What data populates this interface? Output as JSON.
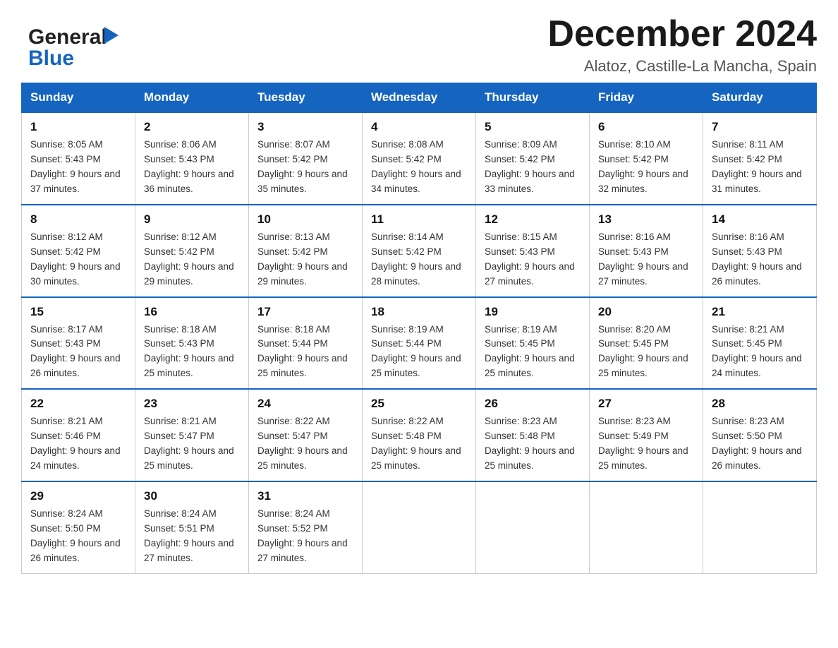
{
  "header": {
    "logo_general": "General",
    "logo_blue": "Blue",
    "month_year": "December 2024",
    "location": "Alatoz, Castille-La Mancha, Spain"
  },
  "weekdays": [
    "Sunday",
    "Monday",
    "Tuesday",
    "Wednesday",
    "Thursday",
    "Friday",
    "Saturday"
  ],
  "weeks": [
    [
      {
        "day": "1",
        "sunrise": "8:05 AM",
        "sunset": "5:43 PM",
        "daylight": "9 hours and 37 minutes."
      },
      {
        "day": "2",
        "sunrise": "8:06 AM",
        "sunset": "5:43 PM",
        "daylight": "9 hours and 36 minutes."
      },
      {
        "day": "3",
        "sunrise": "8:07 AM",
        "sunset": "5:42 PM",
        "daylight": "9 hours and 35 minutes."
      },
      {
        "day": "4",
        "sunrise": "8:08 AM",
        "sunset": "5:42 PM",
        "daylight": "9 hours and 34 minutes."
      },
      {
        "day": "5",
        "sunrise": "8:09 AM",
        "sunset": "5:42 PM",
        "daylight": "9 hours and 33 minutes."
      },
      {
        "day": "6",
        "sunrise": "8:10 AM",
        "sunset": "5:42 PM",
        "daylight": "9 hours and 32 minutes."
      },
      {
        "day": "7",
        "sunrise": "8:11 AM",
        "sunset": "5:42 PM",
        "daylight": "9 hours and 31 minutes."
      }
    ],
    [
      {
        "day": "8",
        "sunrise": "8:12 AM",
        "sunset": "5:42 PM",
        "daylight": "9 hours and 30 minutes."
      },
      {
        "day": "9",
        "sunrise": "8:12 AM",
        "sunset": "5:42 PM",
        "daylight": "9 hours and 29 minutes."
      },
      {
        "day": "10",
        "sunrise": "8:13 AM",
        "sunset": "5:42 PM",
        "daylight": "9 hours and 29 minutes."
      },
      {
        "day": "11",
        "sunrise": "8:14 AM",
        "sunset": "5:42 PM",
        "daylight": "9 hours and 28 minutes."
      },
      {
        "day": "12",
        "sunrise": "8:15 AM",
        "sunset": "5:43 PM",
        "daylight": "9 hours and 27 minutes."
      },
      {
        "day": "13",
        "sunrise": "8:16 AM",
        "sunset": "5:43 PM",
        "daylight": "9 hours and 27 minutes."
      },
      {
        "day": "14",
        "sunrise": "8:16 AM",
        "sunset": "5:43 PM",
        "daylight": "9 hours and 26 minutes."
      }
    ],
    [
      {
        "day": "15",
        "sunrise": "8:17 AM",
        "sunset": "5:43 PM",
        "daylight": "9 hours and 26 minutes."
      },
      {
        "day": "16",
        "sunrise": "8:18 AM",
        "sunset": "5:43 PM",
        "daylight": "9 hours and 25 minutes."
      },
      {
        "day": "17",
        "sunrise": "8:18 AM",
        "sunset": "5:44 PM",
        "daylight": "9 hours and 25 minutes."
      },
      {
        "day": "18",
        "sunrise": "8:19 AM",
        "sunset": "5:44 PM",
        "daylight": "9 hours and 25 minutes."
      },
      {
        "day": "19",
        "sunrise": "8:19 AM",
        "sunset": "5:45 PM",
        "daylight": "9 hours and 25 minutes."
      },
      {
        "day": "20",
        "sunrise": "8:20 AM",
        "sunset": "5:45 PM",
        "daylight": "9 hours and 25 minutes."
      },
      {
        "day": "21",
        "sunrise": "8:21 AM",
        "sunset": "5:45 PM",
        "daylight": "9 hours and 24 minutes."
      }
    ],
    [
      {
        "day": "22",
        "sunrise": "8:21 AM",
        "sunset": "5:46 PM",
        "daylight": "9 hours and 24 minutes."
      },
      {
        "day": "23",
        "sunrise": "8:21 AM",
        "sunset": "5:47 PM",
        "daylight": "9 hours and 25 minutes."
      },
      {
        "day": "24",
        "sunrise": "8:22 AM",
        "sunset": "5:47 PM",
        "daylight": "9 hours and 25 minutes."
      },
      {
        "day": "25",
        "sunrise": "8:22 AM",
        "sunset": "5:48 PM",
        "daylight": "9 hours and 25 minutes."
      },
      {
        "day": "26",
        "sunrise": "8:23 AM",
        "sunset": "5:48 PM",
        "daylight": "9 hours and 25 minutes."
      },
      {
        "day": "27",
        "sunrise": "8:23 AM",
        "sunset": "5:49 PM",
        "daylight": "9 hours and 25 minutes."
      },
      {
        "day": "28",
        "sunrise": "8:23 AM",
        "sunset": "5:50 PM",
        "daylight": "9 hours and 26 minutes."
      }
    ],
    [
      {
        "day": "29",
        "sunrise": "8:24 AM",
        "sunset": "5:50 PM",
        "daylight": "9 hours and 26 minutes."
      },
      {
        "day": "30",
        "sunrise": "8:24 AM",
        "sunset": "5:51 PM",
        "daylight": "9 hours and 27 minutes."
      },
      {
        "day": "31",
        "sunrise": "8:24 AM",
        "sunset": "5:52 PM",
        "daylight": "9 hours and 27 minutes."
      },
      null,
      null,
      null,
      null
    ]
  ]
}
